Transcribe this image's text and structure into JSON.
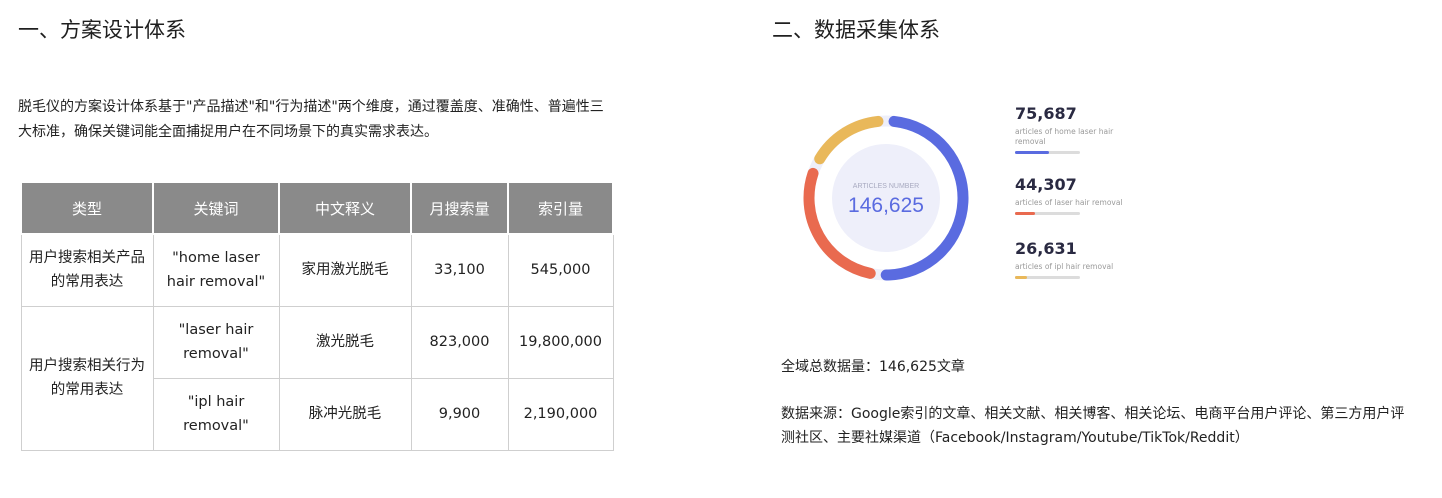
{
  "left": {
    "heading": "一、方案设计体系",
    "intro": "脱毛仪的方案设计体系基于\"产品描述\"和\"行为描述\"两个维度，通过覆盖度、准确性、普遍性三大标准，确保关键词能全面捕捉用户在不同场景下的真实需求表达。",
    "table": {
      "headers": [
        "类型",
        "关键词",
        "中文释义",
        "月搜索量",
        "索引量"
      ],
      "groups": [
        {
          "type": "用户搜索相关产品的常用表达",
          "rows": [
            {
              "keyword": "\"home laser hair removal\"",
              "meaning": "家用激光脱毛",
              "monthly": "33,100",
              "index": "545,000"
            }
          ]
        },
        {
          "type": "用户搜索相关行为的常用表达",
          "rows": [
            {
              "keyword": "\"laser hair removal\"",
              "meaning": "激光脱毛",
              "monthly": "823,000",
              "index": "19,800,000"
            },
            {
              "keyword": "\"ipl hair removal\"",
              "meaning": "脉冲光脱毛",
              "monthly": "9,900",
              "index": "2,190,000"
            }
          ]
        }
      ]
    }
  },
  "right": {
    "heading": "二、数据采集体系",
    "donut": {
      "center_label": "ARTICLES NUMBER",
      "center_value": "146,625",
      "total": 146625,
      "colors": {
        "track": "#eeeffa",
        "center": "#eeeffa",
        "value_text": "#5a6be0"
      }
    },
    "stats": [
      {
        "value": 75687,
        "value_text": "75,687",
        "desc": "articles of home laser hair removal",
        "color": "#5a6be0"
      },
      {
        "value": 44307,
        "value_text": "44,307",
        "desc": "articles of laser hair removal",
        "color": "#e96a4f"
      },
      {
        "value": 26631,
        "value_text": "26,631",
        "desc": "articles of ipl hair removal",
        "color": "#e9b85a"
      }
    ],
    "total_text": "全域总数据量：146,625文章",
    "source_text": "数据来源：Google索引的文章、相关文献、相关博客、相关论坛、电商平台用户评论、第三方用户评测社区、主要社媒渠道（Facebook/Instagram/Youtube/TikTok/Reddit）"
  }
}
